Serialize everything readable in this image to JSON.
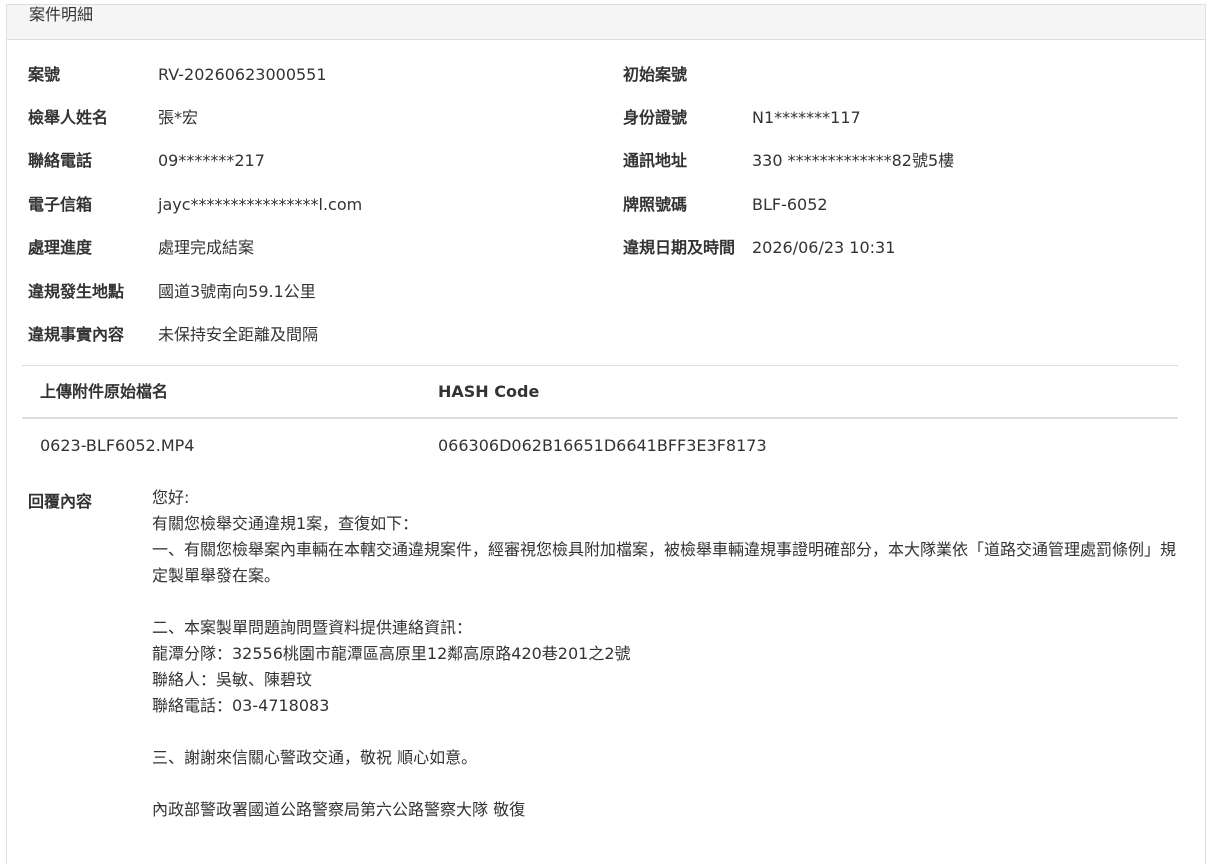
{
  "panel": {
    "title": "案件明細"
  },
  "fields": {
    "case_no": {
      "label": "案號",
      "value": "RV-20260623000551"
    },
    "original_case_no": {
      "label": "初始案號",
      "value": ""
    },
    "reporter_name": {
      "label": "檢舉人姓名",
      "value": "張*宏"
    },
    "id_number": {
      "label": "身份證號",
      "value": "N1*******117"
    },
    "phone": {
      "label": "聯絡電話",
      "value": "09*******217"
    },
    "address": {
      "label": "通訊地址",
      "value": "330 *************82號5樓"
    },
    "email": {
      "label": "電子信箱",
      "value": "jayc****************l.com"
    },
    "plate": {
      "label": "牌照號碼",
      "value": "BLF-6052"
    },
    "progress": {
      "label": "處理進度",
      "value": "處理完成結案"
    },
    "violation_datetime": {
      "label": "違規日期及時間",
      "value": "2026/06/23 10:31"
    },
    "location": {
      "label": "違規發生地點",
      "value": "國道3號南向59.1公里"
    },
    "facts": {
      "label": "違規事實內容",
      "value": "未保持安全距離及間隔"
    }
  },
  "attachments": {
    "headers": {
      "filename": "上傳附件原始檔名",
      "hash": "HASH Code"
    },
    "rows": [
      {
        "filename": "0623-BLF6052.MP4",
        "hash": "066306D062B16651D6641BFF3E3F8173"
      }
    ]
  },
  "reply": {
    "label": "回覆內容",
    "lines": [
      "您好:",
      "有關您檢舉交通違規1案，查復如下：",
      "一、有關您檢舉案內車輛在本轄交通違規案件，經審視您檢具附加檔案，被檢舉車輛違規事證明確部分，本大隊業依「道路交通管理處罰條例」規定製單舉發在案。",
      "",
      "二、本案製單問題詢問暨資料提供連絡資訊：",
      "龍潭分隊：32556桃園市龍潭區高原里12鄰高原路420巷201之2號",
      "聯絡人：吳敏、陳碧玟",
      "聯絡電話：03-4718083",
      "",
      "三、謝謝來信關心警政交通，敬祝 順心如意。",
      "",
      "內政部警政署國道公路警察局第六公路警察大隊 敬復"
    ]
  }
}
